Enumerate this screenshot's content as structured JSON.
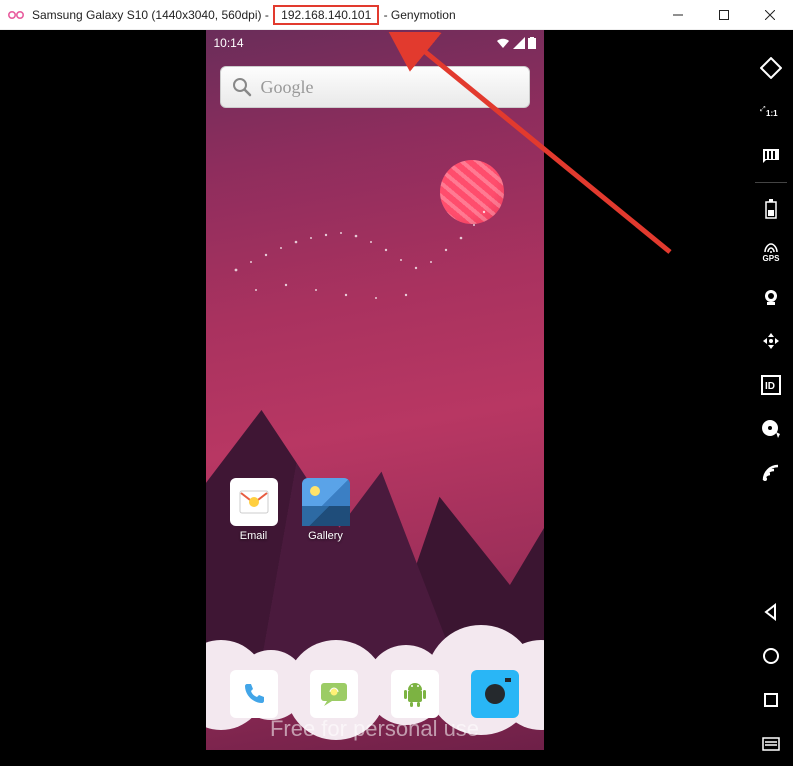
{
  "titlebar": {
    "device": "Samsung Galaxy S10 (1440x3040, 560dpi)",
    "sep1": " - ",
    "ip": "192.168.140.101",
    "sep2": " - ",
    "brand": "Genymotion"
  },
  "statusbar": {
    "time": "10:14"
  },
  "search": {
    "placeholder": "Google"
  },
  "apps": {
    "email": "Email",
    "gallery": "Gallery"
  },
  "watermark": "Free for personal use",
  "sidebar": {
    "gps_label": "GPS"
  }
}
